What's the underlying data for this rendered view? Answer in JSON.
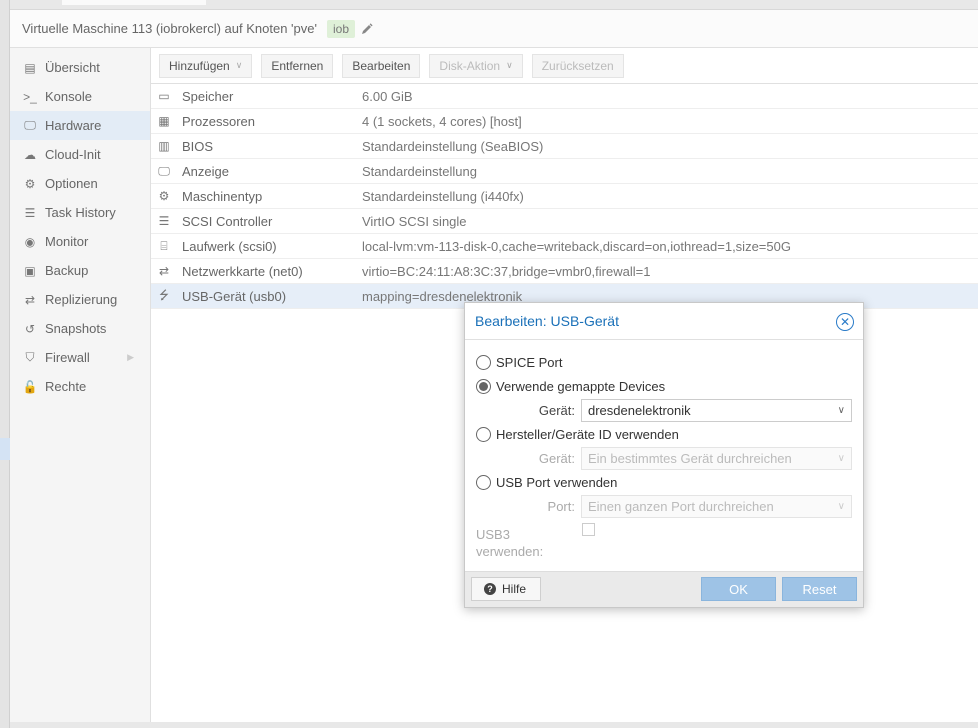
{
  "header": {
    "title": "Virtuelle Maschine 113 (iobrokercl) auf Knoten 'pve'",
    "tag": "iob"
  },
  "nav": {
    "items": [
      {
        "label": "Übersicht",
        "icon": "book-icon"
      },
      {
        "label": "Konsole",
        "icon": "terminal-icon"
      },
      {
        "label": "Hardware",
        "icon": "desktop-icon"
      },
      {
        "label": "Cloud-Init",
        "icon": "cloud-icon"
      },
      {
        "label": "Optionen",
        "icon": "gear-icon"
      },
      {
        "label": "Task History",
        "icon": "list-icon"
      },
      {
        "label": "Monitor",
        "icon": "eye-icon"
      },
      {
        "label": "Backup",
        "icon": "floppy-icon"
      },
      {
        "label": "Replizierung",
        "icon": "retweet-icon"
      },
      {
        "label": "Snapshots",
        "icon": "history-icon"
      },
      {
        "label": "Firewall",
        "icon": "shield-icon"
      },
      {
        "label": "Rechte",
        "icon": "unlock-icon"
      }
    ]
  },
  "toolbar": {
    "add": "Hinzufügen",
    "remove": "Entfernen",
    "edit": "Bearbeiten",
    "disk_action": "Disk-Aktion",
    "revert": "Zurücksetzen"
  },
  "hardware": [
    {
      "name": "Speicher",
      "value": "6.00 GiB",
      "icon": "memory-icon"
    },
    {
      "name": "Prozessoren",
      "value": "4 (1 sockets, 4 cores) [host]",
      "icon": "cpu-icon"
    },
    {
      "name": "BIOS",
      "value": "Standardeinstellung (SeaBIOS)",
      "icon": "microchip-icon"
    },
    {
      "name": "Anzeige",
      "value": "Standardeinstellung",
      "icon": "desktop-icon"
    },
    {
      "name": "Maschinentyp",
      "value": "Standardeinstellung (i440fx)",
      "icon": "cogs-icon"
    },
    {
      "name": "SCSI Controller",
      "value": "VirtIO SCSI single",
      "icon": "database-icon"
    },
    {
      "name": "Laufwerk (scsi0)",
      "value": "local-lvm:vm-113-disk-0,cache=writeback,discard=on,iothread=1,size=50G",
      "icon": "hdd-icon"
    },
    {
      "name": "Netzwerkkarte (net0)",
      "value": "virtio=BC:24:11:A8:3C:37,bridge=vmbr0,firewall=1",
      "icon": "exchange-icon"
    },
    {
      "name": "USB-Gerät (usb0)",
      "value": "mapping=dresdenelektronik",
      "icon": "usb-icon"
    }
  ],
  "dialog": {
    "title": "Bearbeiten: USB-Gerät",
    "opt_spice": "SPICE Port",
    "opt_mapped": "Verwende gemappte Devices",
    "device_label": "Gerät:",
    "device_value": "dresdenelektronik",
    "opt_vendor": "Hersteller/Geräte ID verwenden",
    "vendor_label": "Gerät:",
    "vendor_placeholder": "Ein bestimmtes Gerät durchreichen",
    "opt_port": "USB Port verwenden",
    "port_label": "Port:",
    "port_placeholder": "Einen ganzen Port durchreichen",
    "usb3_label_1": "USB3",
    "usb3_label_2": "verwenden:",
    "help": "Hilfe",
    "ok": "OK",
    "reset": "Reset"
  }
}
